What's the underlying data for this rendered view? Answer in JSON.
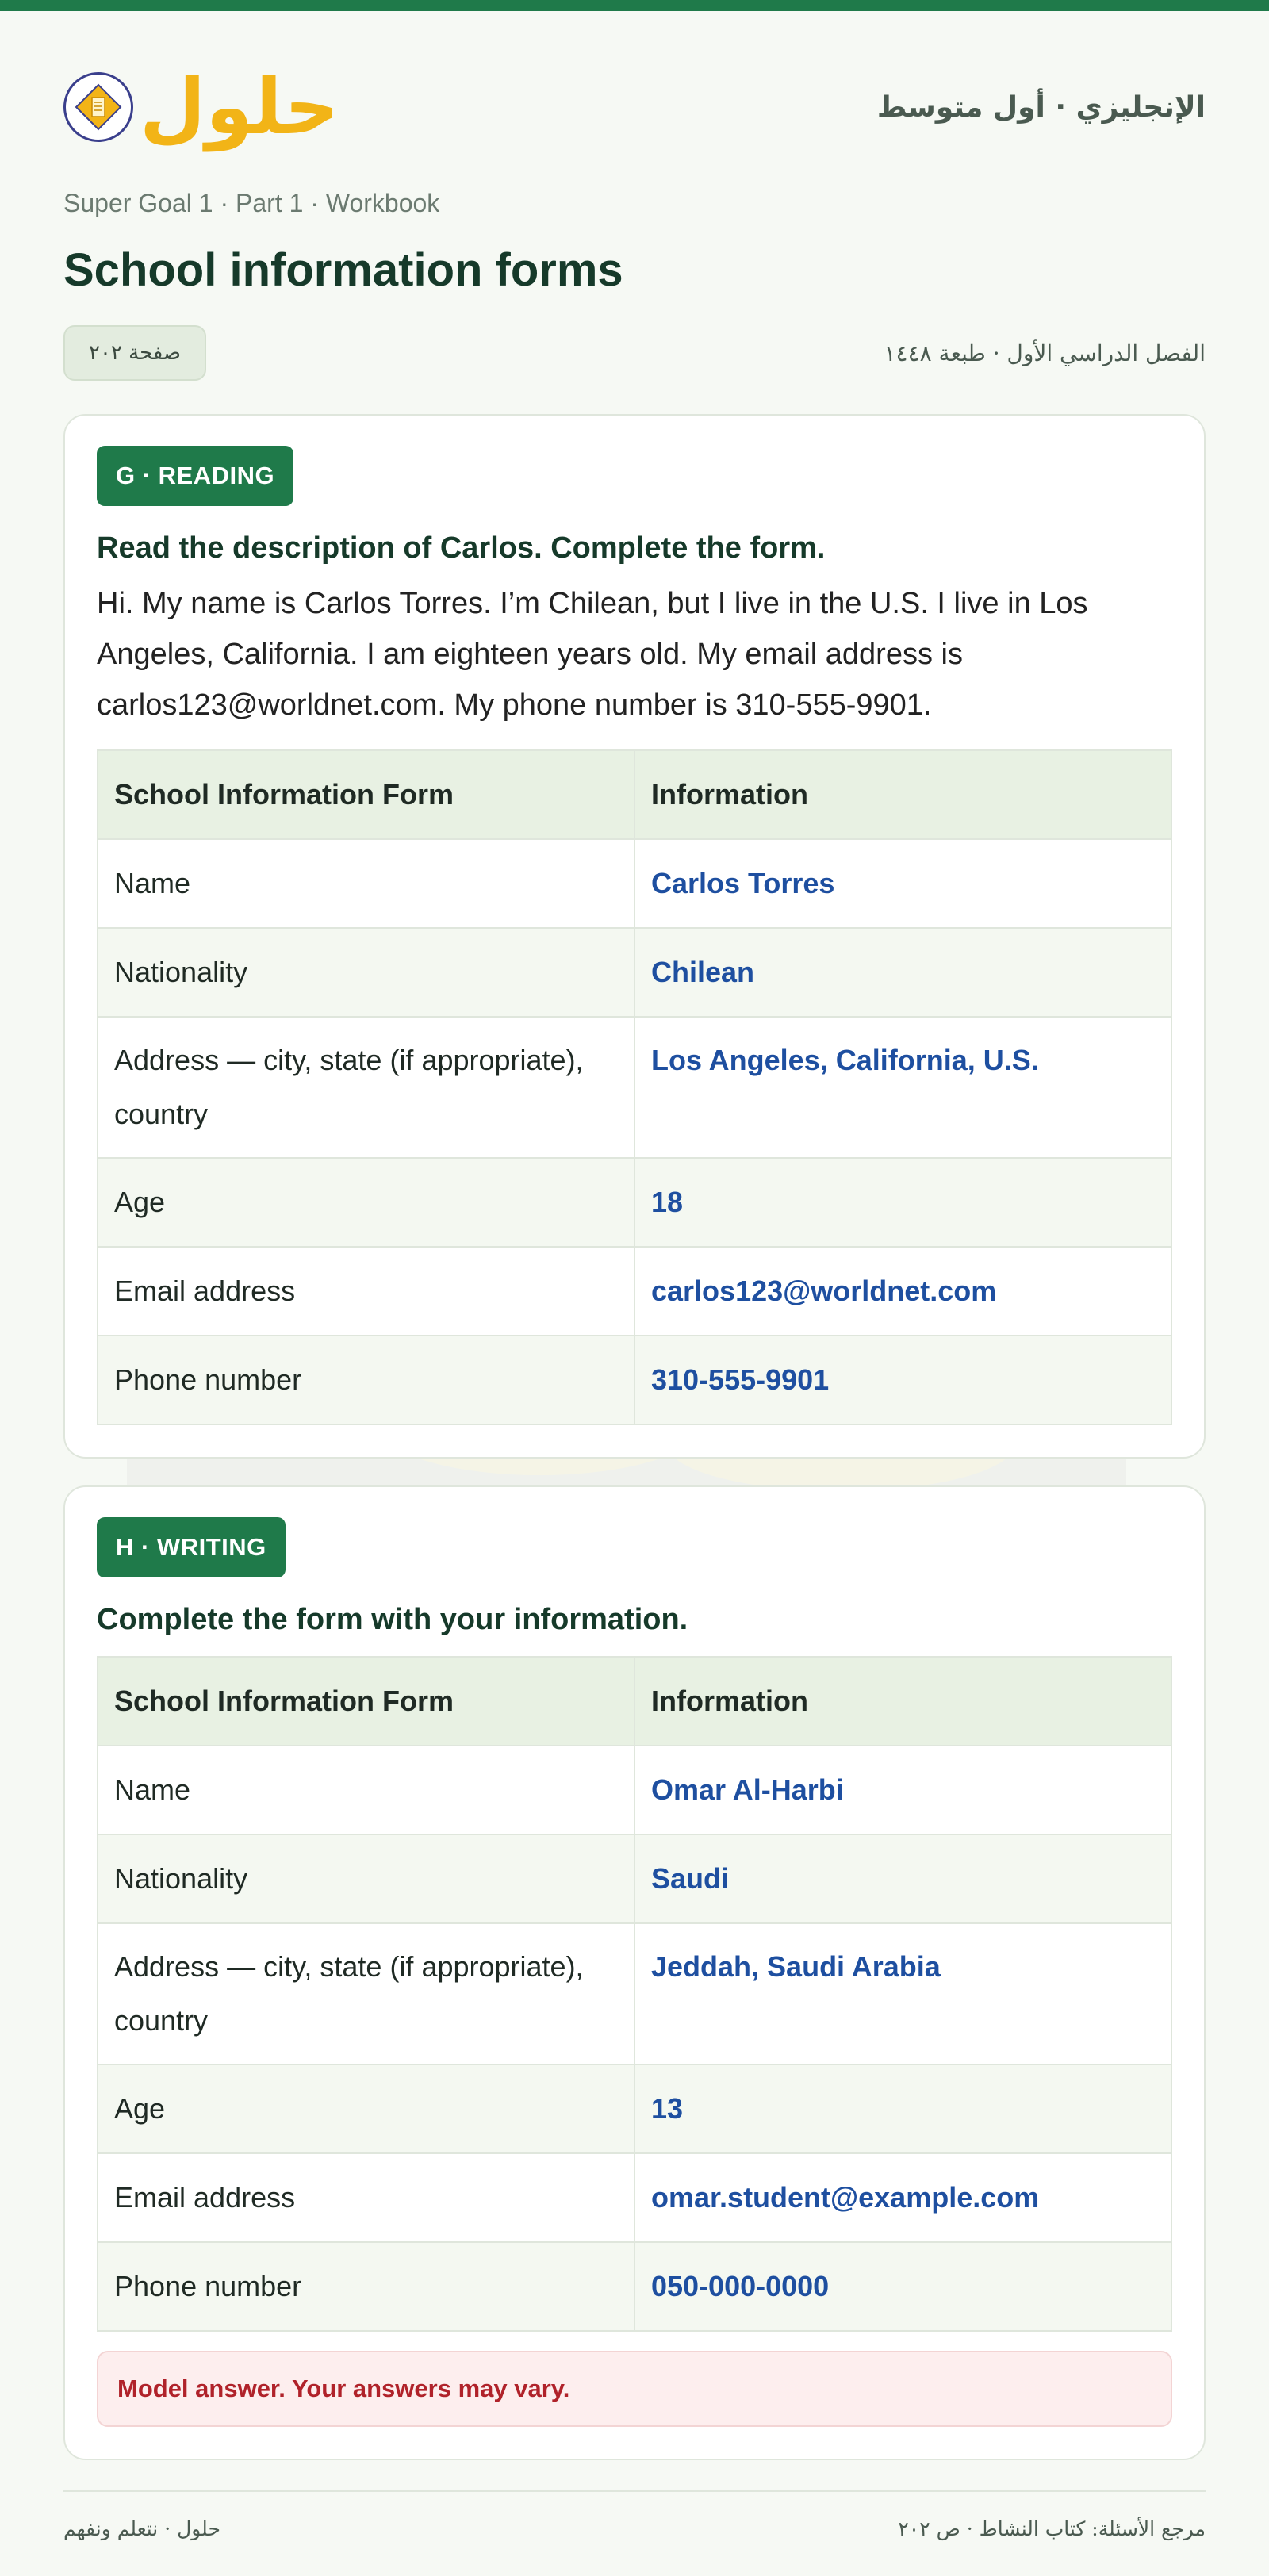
{
  "header": {
    "logo_text": "حلول",
    "subject": "الإنجليزي · أول متوسط"
  },
  "breadcrumb": "Super Goal 1 · Part 1 · Workbook",
  "page_title": "School information forms",
  "page_badge": "صفحة ٢٠٢",
  "edition": "الفصل الدراسي الأول · طبعة ١٤٤٨",
  "colors": {
    "brand_green": "#1f7a4a",
    "answer_blue": "#1e4fa0",
    "note_red": "#b0222a",
    "logo_yellow": "#f2b417"
  },
  "reading": {
    "tag": "G · READING",
    "instruction": "Read the description of Carlos. Complete the form.",
    "passage": "Hi. My name is Carlos Torres. I’m Chilean, but I live in the U.S. I live in Los Angeles, California. I am eighteen years old. My email address is carlos123@worldnet.com. My phone number is 310-555-9901.",
    "table": {
      "col1": "School Information Form",
      "col2": "Information",
      "rows": [
        {
          "field": "Name",
          "value": "Carlos Torres"
        },
        {
          "field": "Nationality",
          "value": "Chilean"
        },
        {
          "field": "Address — city, state (if appropriate), country",
          "value": "Los Angeles, California, U.S."
        },
        {
          "field": "Age",
          "value": "18"
        },
        {
          "field": "Email address",
          "value": "carlos123@worldnet.com"
        },
        {
          "field": "Phone number",
          "value": "310-555-9901"
        }
      ]
    }
  },
  "writing": {
    "tag": "H · WRITING",
    "instruction": "Complete the form with your information.",
    "table": {
      "col1": "School Information Form",
      "col2": "Information",
      "rows": [
        {
          "field": "Name",
          "value": "Omar Al-Harbi"
        },
        {
          "field": "Nationality",
          "value": "Saudi"
        },
        {
          "field": "Address — city, state (if appropriate), country",
          "value": "Jeddah, Saudi Arabia"
        },
        {
          "field": "Age",
          "value": "13"
        },
        {
          "field": "Email address",
          "value": "omar.student@example.com"
        },
        {
          "field": "Phone number",
          "value": "050-000-0000"
        }
      ]
    },
    "note": "Model answer. Your answers may vary."
  },
  "footer": {
    "left": "حلول · نتعلم ونفهم",
    "right": "مرجع الأسئلة: كتاب النشاط · ص ٢٠٢"
  }
}
